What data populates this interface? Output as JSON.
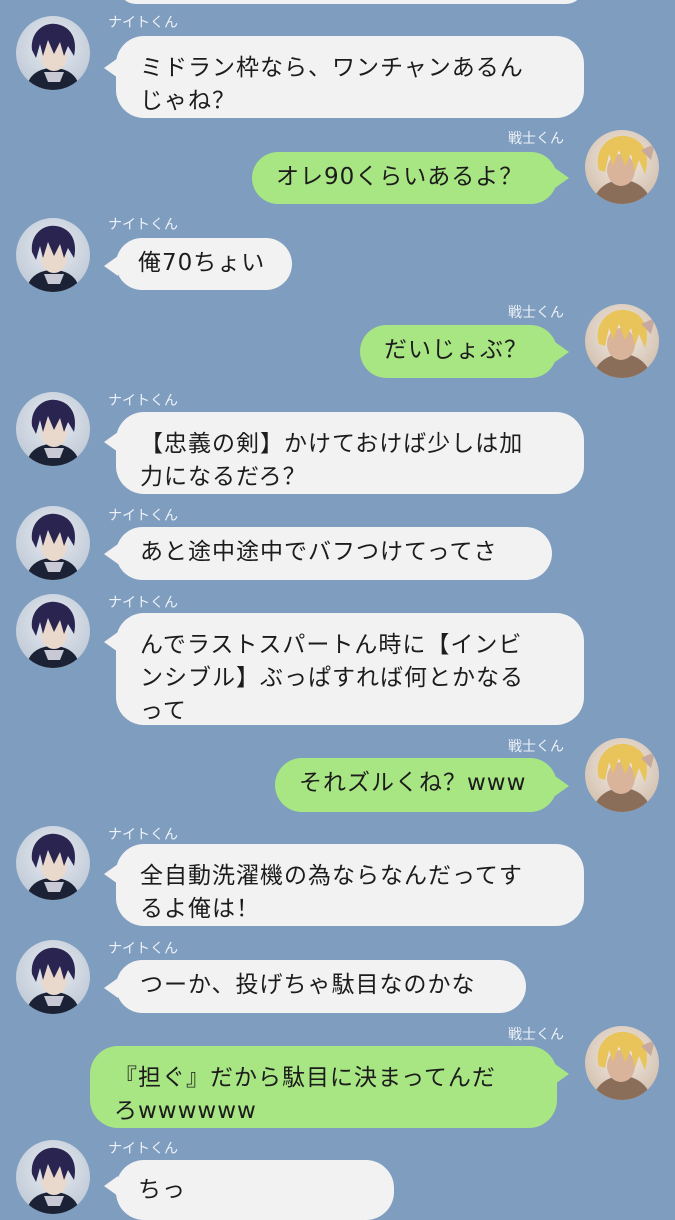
{
  "chat": {
    "knight_name": "ナイトくん",
    "warrior_name": "戦士くん",
    "messages": [
      {
        "text": "ミドラン枠なら、ワンチャンあるん\nじゃね？"
      },
      {
        "text": "オレ90くらいあるよ？"
      },
      {
        "text": "俺70ちょい"
      },
      {
        "text": "だいじょぶ？"
      },
      {
        "text": "【忠義の剣】かけておけば少しは加\n力になるだろ？"
      },
      {
        "text": "あと途中途中でバフつけてってさ"
      },
      {
        "text": "んでラストスパートん時に【インビ\nンシブル】ぶっぱすれば何とかなる\nって"
      },
      {
        "text": "それズルくね？www"
      },
      {
        "text": "全自動洗濯機の為ならなんだってす\nるよ俺は！"
      },
      {
        "text": "つーか、投げちゃ駄目なのかな"
      },
      {
        "text": "『担ぐ』だから駄目に決まってんだ\nろwwwwww"
      },
      {
        "text": "ちっ"
      }
    ]
  },
  "icons": {
    "knight_avatar": "knight-avatar-icon",
    "warrior_avatar": "warrior-avatar-icon"
  },
  "colors": {
    "background": "#7f9dbf",
    "left_bubble": "#f2f2f2",
    "right_bubble": "#a8e583"
  }
}
